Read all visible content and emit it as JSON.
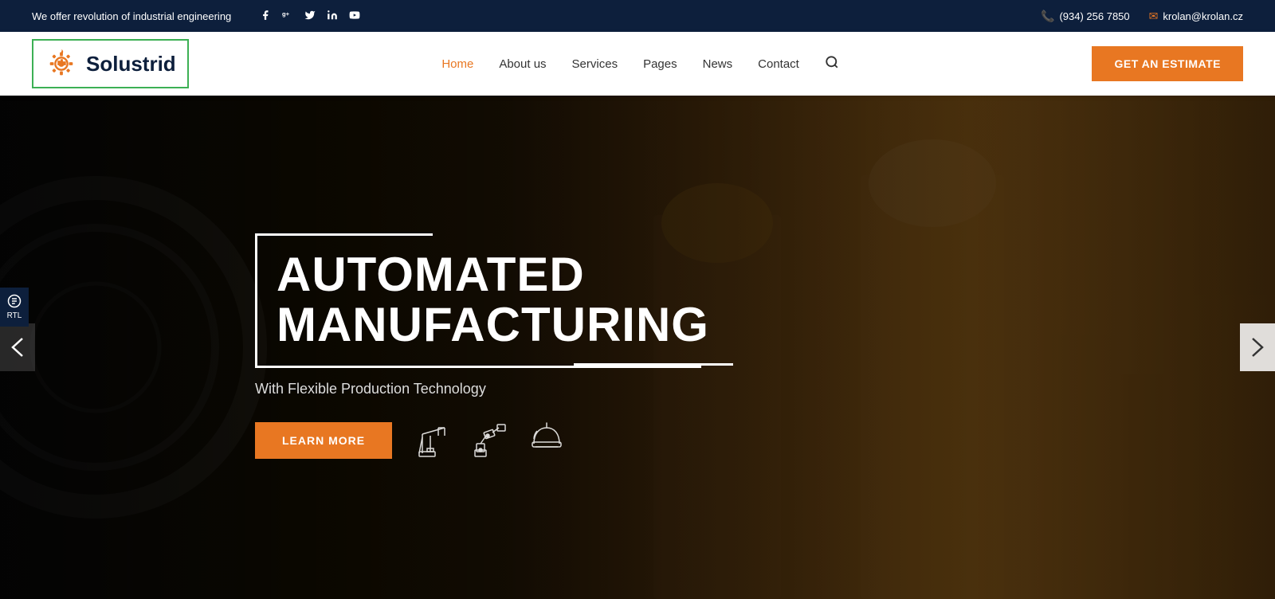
{
  "topbar": {
    "tagline": "We offer revolution of industrial engineering",
    "social": [
      {
        "name": "facebook",
        "icon": "f"
      },
      {
        "name": "google-plus",
        "icon": "g+"
      },
      {
        "name": "twitter",
        "icon": "t"
      },
      {
        "name": "linkedin",
        "icon": "in"
      },
      {
        "name": "youtube",
        "icon": "yt"
      }
    ],
    "phone": "(934) 256 7850",
    "email": "krolan@krolan.cz"
  },
  "header": {
    "logo_text": "Solustrid",
    "nav": [
      {
        "label": "Home",
        "active": true
      },
      {
        "label": "About us",
        "active": false
      },
      {
        "label": "Services",
        "active": false
      },
      {
        "label": "Pages",
        "active": false
      },
      {
        "label": "News",
        "active": false
      },
      {
        "label": "Contact",
        "active": false
      }
    ],
    "cta_label": "GET AN ESTIMATE"
  },
  "hero": {
    "title_line1": "AUTOMATED",
    "title_line2": "MANUFACTURING",
    "subtitle": "With Flexible Production Technology",
    "cta_label": "LEARN MORE",
    "icons": [
      "crane-icon",
      "robotic-arm-icon",
      "helmet-icon"
    ]
  },
  "rtl": {
    "label": "RTL"
  }
}
